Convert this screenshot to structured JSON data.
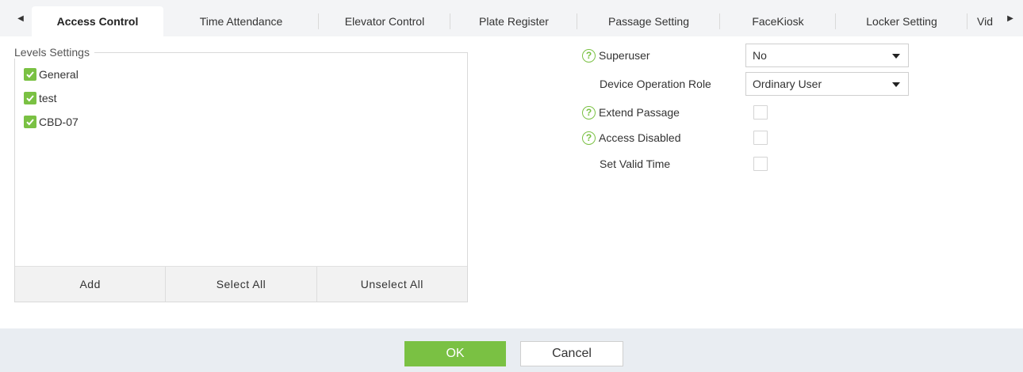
{
  "tabs": [
    {
      "label": "Access Control",
      "active": true
    },
    {
      "label": "Time Attendance",
      "active": false
    },
    {
      "label": "Elevator Control",
      "active": false
    },
    {
      "label": "Plate Register",
      "active": false
    },
    {
      "label": "Passage Setting",
      "active": false
    },
    {
      "label": "FaceKiosk",
      "active": false
    },
    {
      "label": "Locker Setting",
      "active": false
    },
    {
      "label": "Vid",
      "active": false
    }
  ],
  "levels": {
    "title": "Levels Settings",
    "items": [
      {
        "label": "General",
        "checked": true
      },
      {
        "label": "test",
        "checked": true
      },
      {
        "label": "CBD-07",
        "checked": true
      }
    ],
    "buttons": {
      "add": "Add",
      "select_all": "Select All",
      "unselect_all": "Unselect All"
    }
  },
  "form": {
    "superuser": {
      "label": "Superuser",
      "value": "No"
    },
    "device_role": {
      "label": "Device Operation Role",
      "value": "Ordinary User"
    },
    "extend_passage": {
      "label": "Extend Passage",
      "checked": false
    },
    "access_disabled": {
      "label": "Access Disabled",
      "checked": false
    },
    "valid_time": {
      "label": "Set Valid Time",
      "checked": false
    }
  },
  "actions": {
    "ok": "OK",
    "cancel": "Cancel"
  },
  "colors": {
    "accent": "#7ac143",
    "tabbar_bg": "#f3f4f6",
    "bottombar_bg": "#e9edf2"
  },
  "icons": {
    "help": "?"
  }
}
